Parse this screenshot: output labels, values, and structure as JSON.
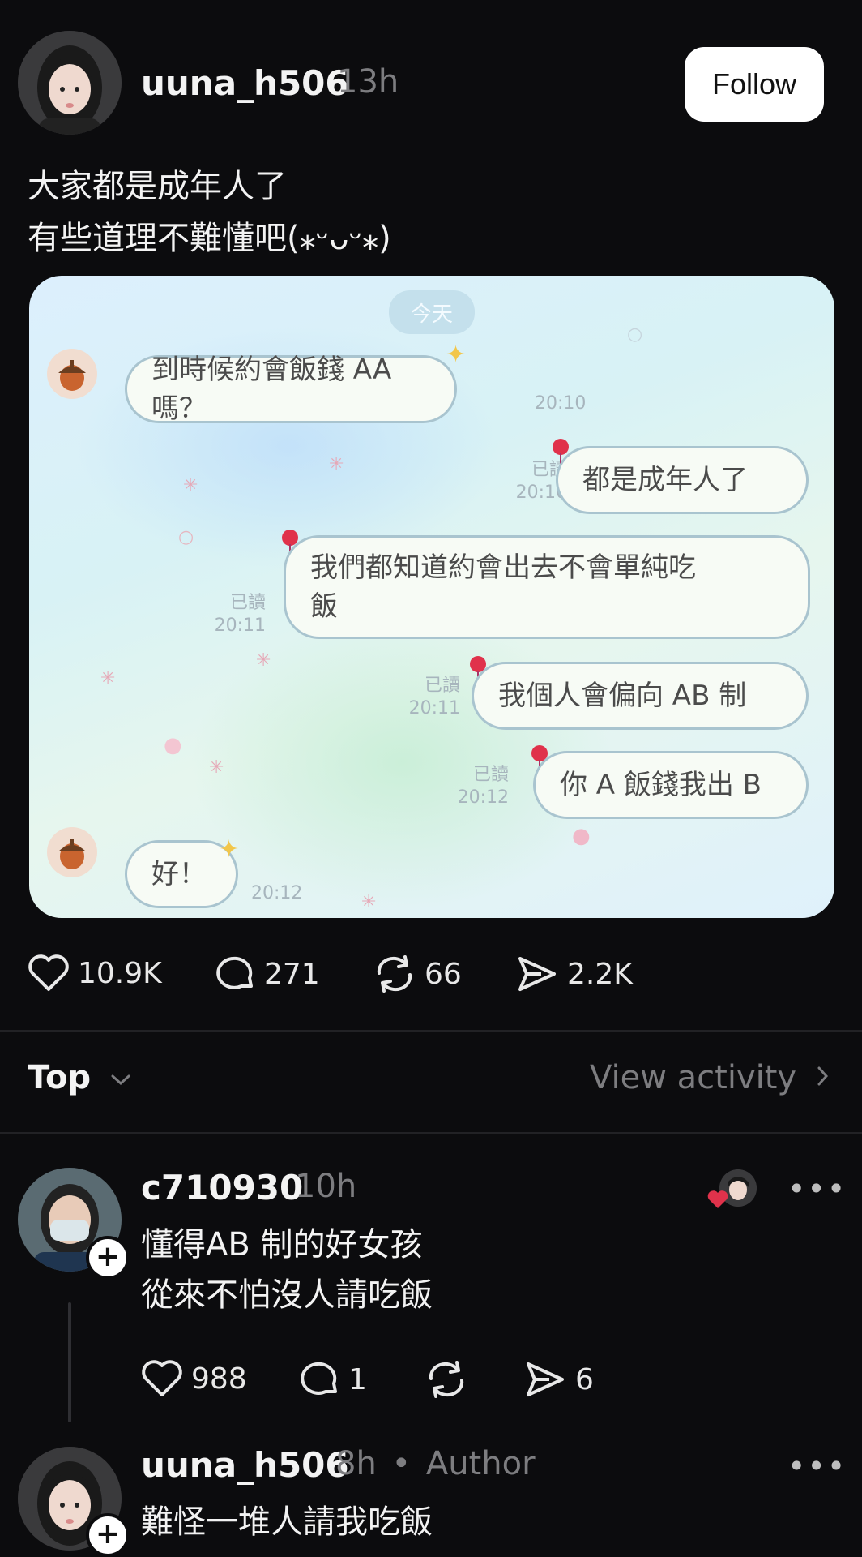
{
  "post": {
    "username": "uuna_h506",
    "time": "13h",
    "follow_label": "Follow",
    "text_line1": "大家都是成年人了",
    "text_line2": "有些道理不難懂吧(⁎ᵕᴗᵕ⁎)",
    "actions": {
      "likes": "10.9K",
      "comments": "271",
      "reposts": "66",
      "shares": "2.2K"
    }
  },
  "chat": {
    "day_label": "今天",
    "messages": [
      {
        "side": "left",
        "text": "到時候約會飯錢 AA 嗎？",
        "time": "20:10"
      },
      {
        "side": "right",
        "text": "都是成年人了",
        "read": "已讀",
        "time": "20:10"
      },
      {
        "side": "right",
        "text_line1": "我們都知道約會出去不會單純吃",
        "text_line2": "飯",
        "read": "已讀",
        "time": "20:11"
      },
      {
        "side": "right",
        "text": "我個人會偏向 AB 制",
        "read": "已讀",
        "time": "20:11"
      },
      {
        "side": "right",
        "text": "你 A 飯錢我出 B",
        "read": "已讀",
        "time": "20:12"
      },
      {
        "side": "left",
        "text": "好！",
        "time": "20:12"
      }
    ]
  },
  "sort": {
    "label": "Top",
    "view_activity": "View activity"
  },
  "comments": [
    {
      "username": "c710930",
      "time": "10h",
      "text_line1": "懂得AB 制的好女孩",
      "text_line2": "從來不怕沒人請吃飯",
      "actions": {
        "likes": "988",
        "comments": "1",
        "shares": "6"
      }
    },
    {
      "username": "uuna_h506",
      "time": "8h",
      "author_tag": "Author",
      "separator": "•",
      "text_line1": "難怪一堆人請我吃飯"
    }
  ],
  "colors": {
    "background": "#0c0c0e",
    "muted": "#7d7d80",
    "like_red": "#e0324b"
  }
}
